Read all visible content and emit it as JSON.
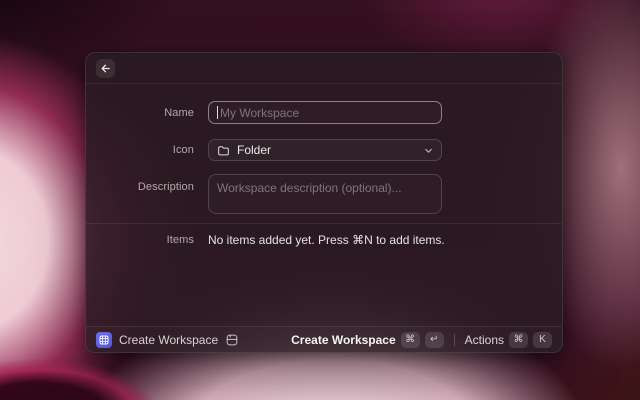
{
  "window": {
    "header": {
      "back_icon": "arrow-left"
    },
    "form": {
      "name_label": "Name",
      "name_placeholder": "My Workspace",
      "icon_label": "Icon",
      "icon_value": "Folder",
      "icon_glyph": "folder",
      "description_label": "Description",
      "description_placeholder": "Workspace description (optional)...",
      "items_label": "Items",
      "items_empty": "No items added yet. Press ⌘N to add items."
    },
    "status_bar": {
      "app_icon": "workspace-grid",
      "app_name": "Create Workspace",
      "save_icon": "save-disk",
      "primary": {
        "label": "Create Workspace",
        "keys": [
          "⌘",
          "↵"
        ]
      },
      "actions": {
        "label": "Actions",
        "keys": [
          "⌘",
          "K"
        ]
      }
    },
    "colors": {
      "app_icon_accent": "#5c5fd9",
      "panel": "#271b21",
      "background_pink": "#efcbd5",
      "background_maroon": "#3e1427"
    }
  }
}
